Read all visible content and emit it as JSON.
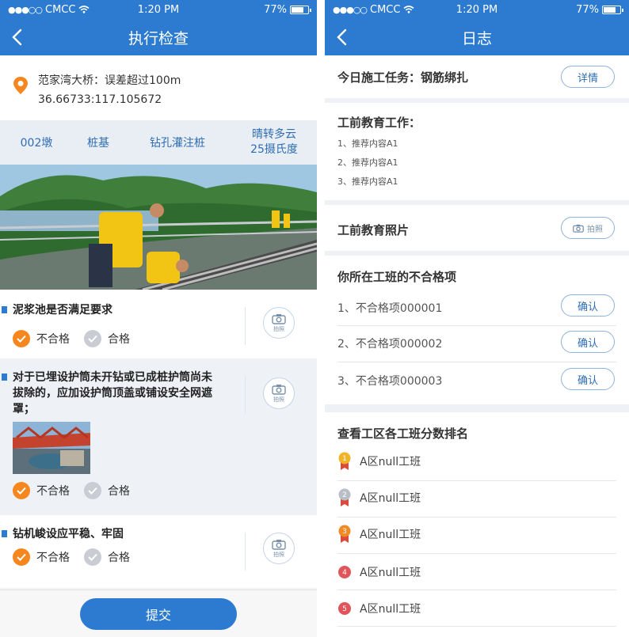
{
  "status_bar": {
    "carrier": "CMCC",
    "time": "1:20 PM",
    "battery": "77%"
  },
  "left": {
    "title": "执行检查",
    "location": {
      "name": "范家湾大桥：误差超过100m",
      "coords": "36.66733:117.105672"
    },
    "info": {
      "pier": "002墩",
      "part": "桩基",
      "method": "钻孔灌注桩",
      "weather_line1": "晴转多云",
      "weather_line2": "25摄氏度"
    },
    "photo_label": "拍照",
    "questions": [
      {
        "title": "泥浆池是否满足要求",
        "fail": "不合格",
        "pass": "合格"
      },
      {
        "title": "对于已埋设护筒未开钻或已成桩护筒尚未拔除的，应加设护筒顶盖或铺设安全网遮罩；",
        "fail": "不合格",
        "pass": "合格"
      },
      {
        "title": "钻机峻设应平稳、牢固",
        "fail": "不合格",
        "pass": "合格"
      }
    ],
    "submit": "提交"
  },
  "right": {
    "title": "日志",
    "task": {
      "label": "今日施工任务：钢筋绑扎",
      "button": "详情"
    },
    "education": {
      "label": "工前教育工作：",
      "items": [
        "1、推荐内容A1",
        "2、推荐内容A1",
        "3、推荐内容A1"
      ]
    },
    "education_photo": {
      "label": "工前教育照片",
      "button": "拍照"
    },
    "defects": {
      "label": "你所在工班的不合格项",
      "items": [
        {
          "text": "1、不合格项000001",
          "button": "确认"
        },
        {
          "text": "2、不合格项000002",
          "button": "确认"
        },
        {
          "text": "3、不合格项000003",
          "button": "确认"
        }
      ]
    },
    "ranking": {
      "label": "查看工区各工班分数排名",
      "items": [
        {
          "rank": "1",
          "name": "A区null工班"
        },
        {
          "rank": "2",
          "name": "A区null工班"
        },
        {
          "rank": "3",
          "name": "A区null工班"
        },
        {
          "rank": "4",
          "name": "A区null工班"
        },
        {
          "rank": "5",
          "name": "A区null工班"
        }
      ]
    }
  },
  "colors": {
    "primary": "#2c7bd0",
    "accent_orange": "#f6871f",
    "badge_gold": "#f0b429",
    "badge_silver": "#b9bec6",
    "badge_bronze": "#f08a24",
    "badge_red": "#e0545a"
  }
}
